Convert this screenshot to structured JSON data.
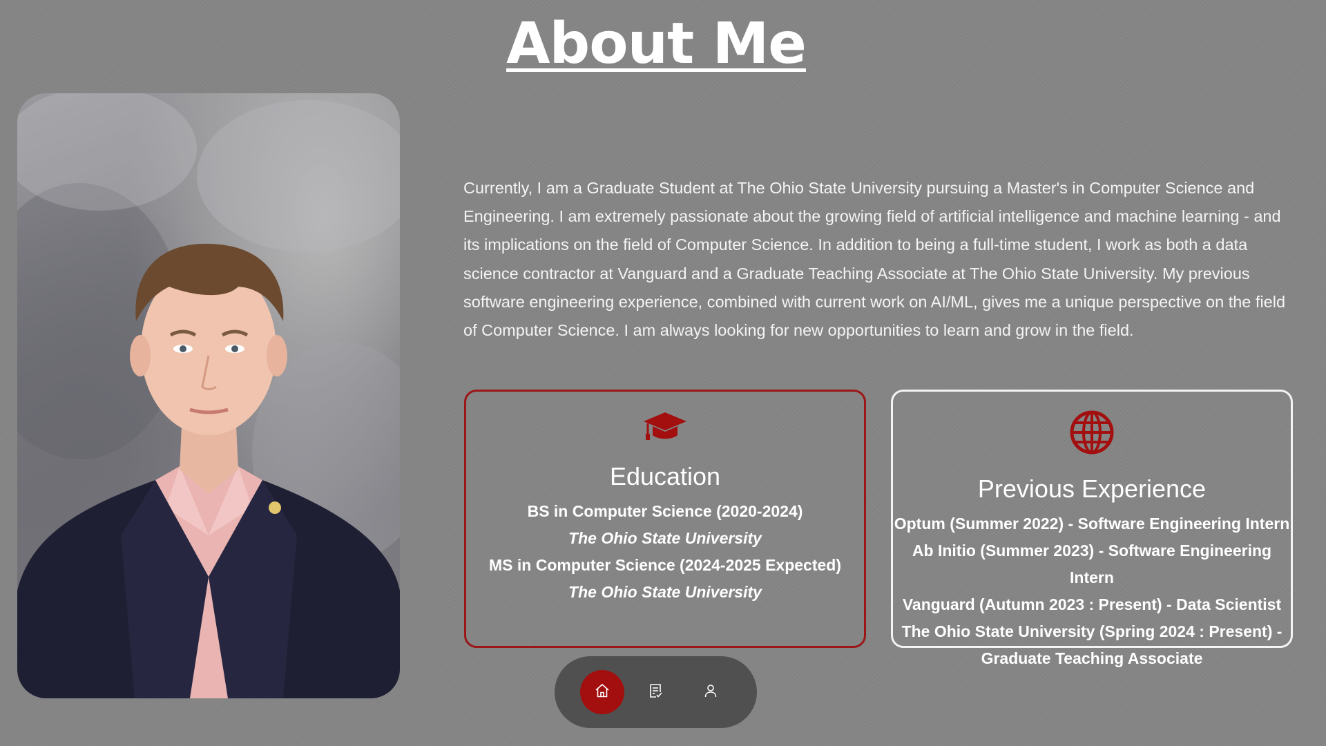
{
  "page": {
    "title": "About Me"
  },
  "profile": {
    "photo_alt": "Headshot of man in navy suit and pink shirt"
  },
  "bio": {
    "text": "Currently, I am a Graduate Student at The Ohio State University pursuing a Master's in Computer Science and Engineering. I am extremely passionate about the growing field of artificial intelligence and machine learning - and its implications on the field of Computer Science. In addition to being a full-time student, I work as both a data science contractor at Vanguard and a Graduate Teaching Associate at The Ohio State University. My previous software engineering experience, combined with current work on AI/ML, gives me a unique perspective on the field of Computer Science. I am always looking for new opportunities to learn and grow in the field."
  },
  "education": {
    "icon": "graduation-cap-icon",
    "title": "Education",
    "lines": [
      "BS in Computer Science (2020-2024)",
      "The Ohio State University",
      "MS in Computer Science (2024-2025 Expected)",
      "The Ohio State University"
    ]
  },
  "experience": {
    "icon": "globe-icon",
    "title": "Previous Experience",
    "lines": [
      "Optum (Summer 2022) - Software Engineering Intern",
      "Ab Initio (Summer 2023) - Software Engineering Intern",
      "Vanguard (Autumn 2023 : Present) - Data Scientist",
      "The Ohio State University (Spring 2024 : Present) -",
      "Graduate Teaching Associate"
    ]
  },
  "nav": {
    "items": [
      {
        "icon": "home-icon",
        "active": true
      },
      {
        "icon": "resume-icon",
        "active": false
      },
      {
        "icon": "user-icon",
        "active": false
      }
    ]
  },
  "colors": {
    "accent": "#a30f0f",
    "background": "#858585",
    "text": "#ffffff",
    "nav_background": "#505050"
  }
}
